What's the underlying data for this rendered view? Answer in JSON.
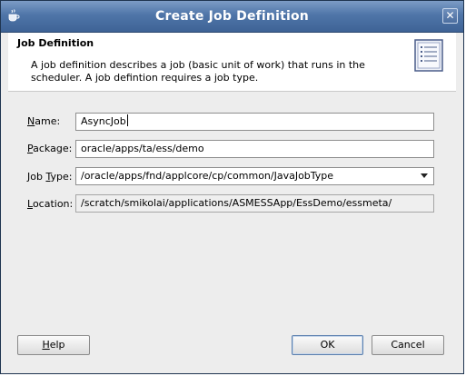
{
  "window": {
    "title": "Create Job Definition"
  },
  "header": {
    "title": "Job Definition",
    "description": "A job definition describes a job (basic unit of work) that runs in the scheduler.  A job defintion requires a job type."
  },
  "form": {
    "name": {
      "mnemonic": "N",
      "label_rest": "ame:",
      "value": "AsyncJob"
    },
    "package": {
      "mnemonic": "P",
      "label_rest": "ackage:",
      "value": "oracle/apps/ta/ess/demo"
    },
    "job_type": {
      "label_pre": "Job ",
      "mnemonic": "T",
      "label_rest": "ype:",
      "value": "/oracle/apps/fnd/applcore/cp/common/JavaJobType"
    },
    "location": {
      "mnemonic": "L",
      "label_rest": "ocation:",
      "value": "/scratch/smikolai/applications/ASMESSApp/EssDemo/essmeta/"
    }
  },
  "buttons": {
    "help": {
      "mnemonic": "H",
      "label_rest": "elp"
    },
    "ok": "OK",
    "cancel": "Cancel"
  },
  "icons": {
    "app": "java-cup-icon",
    "close": "close-icon",
    "header": "document-list-icon",
    "combo": "chevron-down-icon"
  }
}
